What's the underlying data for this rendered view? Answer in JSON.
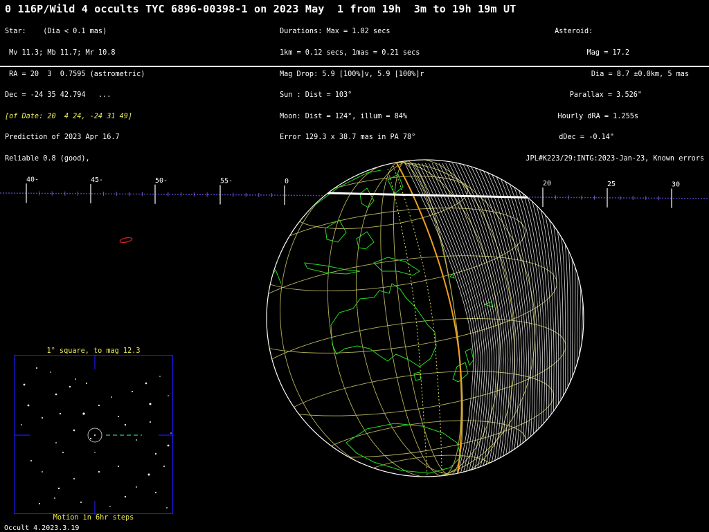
{
  "title": "0 116P/Wild 4 occults TYC 6896-00398-1 on 2023 May  1 from 19h  3m to 19h 19m UT",
  "star": {
    "lines": [
      "Star:    (Dia < 0.1 mas)",
      " Mv 11.3; Mb 11.7; Mr 10.8",
      " RA = 20  3  0.7595 (astrometric)",
      "Dec = -24 35 42.794   ...",
      "[of Date: 20  4 24, -24 31 49]",
      "Prediction of 2023 Apr 16.7",
      "Reliable 0.8 (good),"
    ]
  },
  "durations": {
    "lines": [
      "Durations: Max = 1.02 secs",
      "1km = 0.12 secs, 1mas = 0.21 secs",
      "Mag Drop: 5.9 [100%]v, 5.9 [100%]r",
      "Sun : Dist = 103°",
      "Moon: Dist = 124°, illum = 84%",
      "Error 129.3 x 38.7 mas in PA 78°"
    ]
  },
  "asteroid": {
    "lines": [
      "Asteroid:     ",
      "Mag = 17.2",
      "Dia = 8.7 ±0.0km, 5 mas",
      "Parallax = 3.526\"",
      "Hourly dRA = 1.255s",
      "dDec = -0.14\"",
      "JPL#K223/29:INTG:2023-Jan-23, Known errors"
    ]
  },
  "scale_labels": [
    {
      "text": "40-"
    },
    {
      "text": "45-"
    },
    {
      "text": "50-"
    },
    {
      "text": "55-"
    },
    {
      "text": "0"
    },
    {
      "text": "20"
    },
    {
      "text": "25"
    },
    {
      "text": "30"
    }
  ],
  "finder_chart": {
    "title": "1° square, to mag 12.3",
    "caption": "Motion in 6hr steps"
  },
  "footer": "Occult 4.2023.3.19",
  "colors": {
    "background": "#000000",
    "coastline": "#22dd22",
    "graticule": "#b8b45a",
    "path_line": "#f0a020",
    "shadow_lines": "#ffffff",
    "scale_track": "#5a3ab8",
    "finder_border": "#1b1bff",
    "error_ellipse": "#cc2020"
  }
}
